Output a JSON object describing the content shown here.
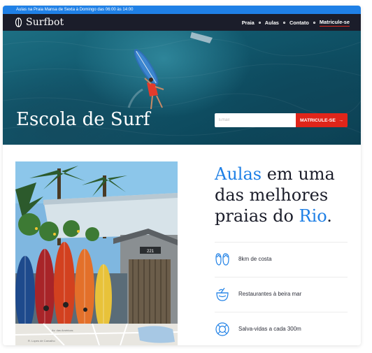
{
  "topbar": {
    "text": "Aulas na Praia Mansa de Sexta à Domingo das 06:00 às 14:00"
  },
  "brand": {
    "name": "Surfbot",
    "icon": "surfboard-icon"
  },
  "nav": {
    "items": [
      "Praia",
      "Aulas",
      "Contato",
      "Matricule-se"
    ]
  },
  "hero": {
    "title": "Escola de Surf",
    "email_placeholder": "Email",
    "signup_label": "MATRICULE-SE",
    "signup_arrow": "→"
  },
  "headline": {
    "w1": "Aulas",
    "w2": " em uma das melhores praias do ",
    "w3": "Rio",
    "w4": "."
  },
  "features": [
    {
      "icon": "flip-flops-icon",
      "label": "8km de costa"
    },
    {
      "icon": "coconut-drink-icon",
      "label": "Restaurantes à beira mar"
    },
    {
      "icon": "lifebuoy-icon",
      "label": "Salva-vidas a cada 300m"
    }
  ],
  "photo": {
    "house_number": "221",
    "map_street_1": "Av. das Américas",
    "map_street_2": "R. Lopes de Carvalho"
  },
  "colors": {
    "accent": "#1f80e6",
    "cta": "#e0251a",
    "dark": "#1b1d2a"
  }
}
